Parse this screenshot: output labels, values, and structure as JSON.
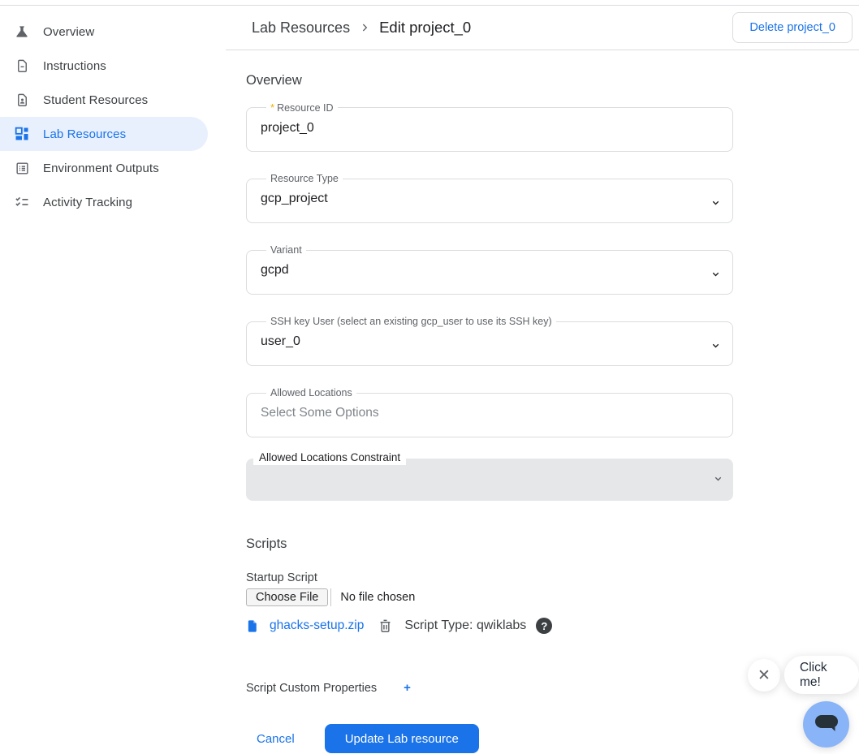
{
  "sidebar": {
    "items": [
      {
        "label": "Overview",
        "icon": "flask-icon",
        "selected": false
      },
      {
        "label": "Instructions",
        "icon": "document-icon",
        "selected": false
      },
      {
        "label": "Student Resources",
        "icon": "student-document-icon",
        "selected": false
      },
      {
        "label": "Lab Resources",
        "icon": "dashboard-icon",
        "selected": true
      },
      {
        "label": "Environment Outputs",
        "icon": "list-icon",
        "selected": false
      },
      {
        "label": "Activity Tracking",
        "icon": "checklist-icon",
        "selected": false
      }
    ]
  },
  "header": {
    "breadcrumb": {
      "parent": "Lab Resources",
      "current": "Edit project_0"
    },
    "delete_button": "Delete project_0"
  },
  "form": {
    "overview_heading": "Overview",
    "resource_id": {
      "label": "Resource ID",
      "required_marker": "*",
      "value": "project_0"
    },
    "resource_type": {
      "label": "Resource Type",
      "value": "gcp_project"
    },
    "variant": {
      "label": "Variant",
      "value": "gcpd"
    },
    "ssh_key_user": {
      "label": "SSH key User (select an existing gcp_user to use its SSH key)",
      "value": "user_0"
    },
    "allowed_locations": {
      "label": "Allowed Locations",
      "placeholder": "Select Some Options"
    },
    "allowed_locations_constraint": {
      "label": "Allowed Locations Constraint",
      "value": ""
    },
    "scripts_heading": "Scripts",
    "startup_script": {
      "label": "Startup Script",
      "choose_file_label": "Choose File",
      "no_file_text": "No file chosen",
      "file_name": "ghacks-setup.zip",
      "script_type_text": "Script Type: qwiklabs",
      "help_glyph": "?"
    },
    "script_custom_properties": {
      "label": "Script Custom Properties",
      "add_label": "+"
    },
    "actions": {
      "cancel": "Cancel",
      "submit": "Update Lab resource"
    }
  },
  "chat_widget": {
    "tooltip": "Click me!",
    "close_glyph": "✕"
  },
  "colors": {
    "accent": "#1a73e8",
    "selected_item_bg": "#e8f0fe",
    "border": "#dadce0",
    "required_marker": "#f9ab00",
    "disabled_field_bg": "#e6e7e9",
    "chat_button_bg": "#8ab4f8",
    "chat_bubble": "#263238"
  }
}
